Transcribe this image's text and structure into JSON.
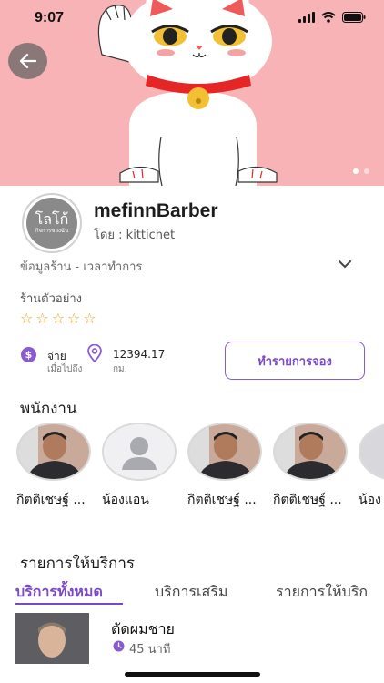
{
  "status_bar": {
    "time": "9:07"
  },
  "hero": {
    "image": "maneki-neko lucky cat",
    "background": "#f7b3b5",
    "carousel": {
      "count": 2,
      "active": 1
    }
  },
  "shop": {
    "name": "mefinnBarber",
    "owner": "โดย : kittichet",
    "logo": {
      "main": "โลโก้",
      "sub": "กิจการของฉัน"
    },
    "info_label": "ข้อมูลร้าน - เวลาทำการ",
    "sample_label": "ร้านตัวอย่าง",
    "rating": {
      "value": 0,
      "max": 5
    }
  },
  "payment": {
    "label": "จ่าย",
    "sub": "เมื่อไปถึง"
  },
  "distance": {
    "value": "12394.17",
    "unit": "กม."
  },
  "booking": {
    "button_label": "ทำรายการจอง"
  },
  "staff": {
    "title": "พนักงาน",
    "items": [
      {
        "name": "กิตติเชษฐ์ ...",
        "avatar": "photo"
      },
      {
        "name": "น้องแอน",
        "avatar": "placeholder"
      },
      {
        "name": "กิตติเชษฐ์ ...",
        "avatar": "photo"
      },
      {
        "name": "กิตติเชษฐ์ ...",
        "avatar": "photo"
      },
      {
        "name": "น้อง",
        "avatar": "photo"
      }
    ]
  },
  "services": {
    "title": "รายการให้บริการ",
    "tabs": [
      "บริการทั้งหมด",
      "บริการเสริม",
      "รายการให้บริก"
    ],
    "active_tab": 0,
    "items": [
      {
        "name": "ตัดผมชาย",
        "duration": "45 นาที"
      }
    ]
  },
  "colors": {
    "accent": "#7b49c8",
    "star": "#e6a823"
  }
}
